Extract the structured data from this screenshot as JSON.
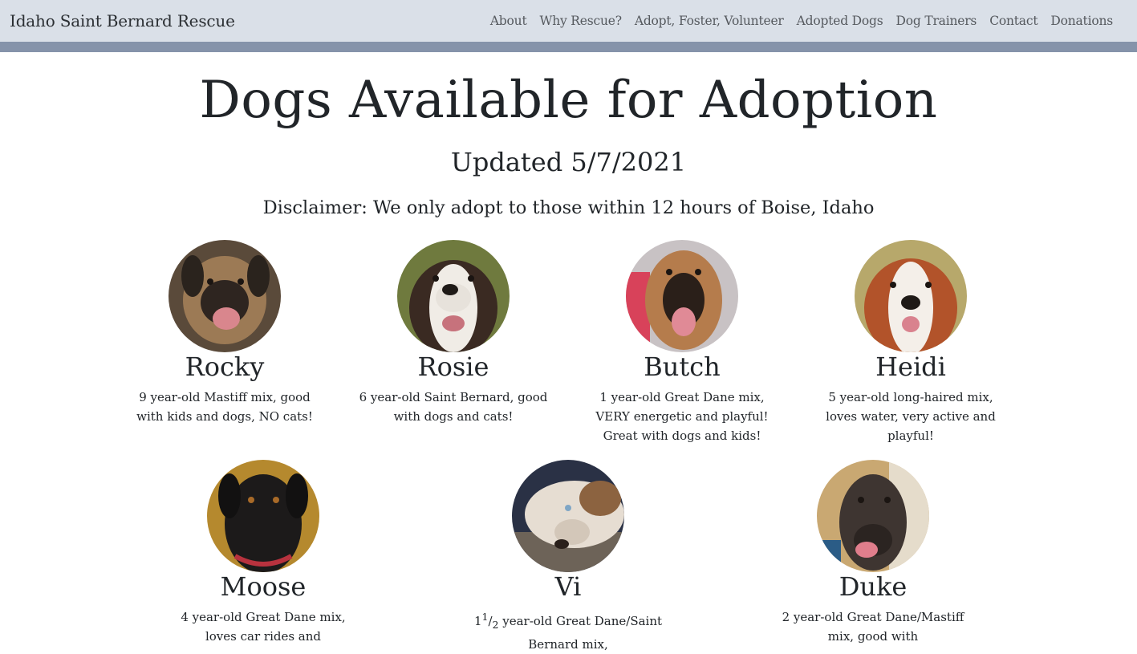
{
  "navbar": {
    "brand": "Idaho Saint Bernard Rescue",
    "links": [
      "About",
      "Why Rescue?",
      "Adopt, Foster, Volunteer",
      "Adopted Dogs",
      "Dog Trainers",
      "Contact",
      "Donations"
    ]
  },
  "main": {
    "title": "Dogs Available for Adoption",
    "updated": "Updated 5/7/2021",
    "disclaimer": "Disclaimer: We only adopt to those within 12 hours of Boise, Idaho"
  },
  "dogs": [
    {
      "name": "Rocky",
      "description": "9 year-old Mastiff mix, good with kids and dogs, NO cats!"
    },
    {
      "name": "Rosie",
      "description": "6 year-old Saint Bernard, good with dogs and cats!"
    },
    {
      "name": "Butch",
      "description": "1 year-old Great Dane mix, VERY energetic and playful! Great with dogs and kids!"
    },
    {
      "name": "Heidi",
      "description": "5 year-old long-haired mix, loves water, very active and playful!"
    },
    {
      "name": "Moose",
      "description": "4 year-old Great Dane mix, loves car rides and"
    },
    {
      "name": "Vi",
      "age_whole": "1",
      "age_num": "1",
      "age_den": "2",
      "description": " year-old Great Dane/Saint Bernard mix,"
    },
    {
      "name": "Duke",
      "description": "2 year-old Great Dane/Mastiff mix, good with"
    }
  ],
  "colors": {
    "navbar_bg": "#dae0e8",
    "navbar_band": "#8593aa",
    "text": "#212529",
    "nav_link": "#55595e"
  }
}
